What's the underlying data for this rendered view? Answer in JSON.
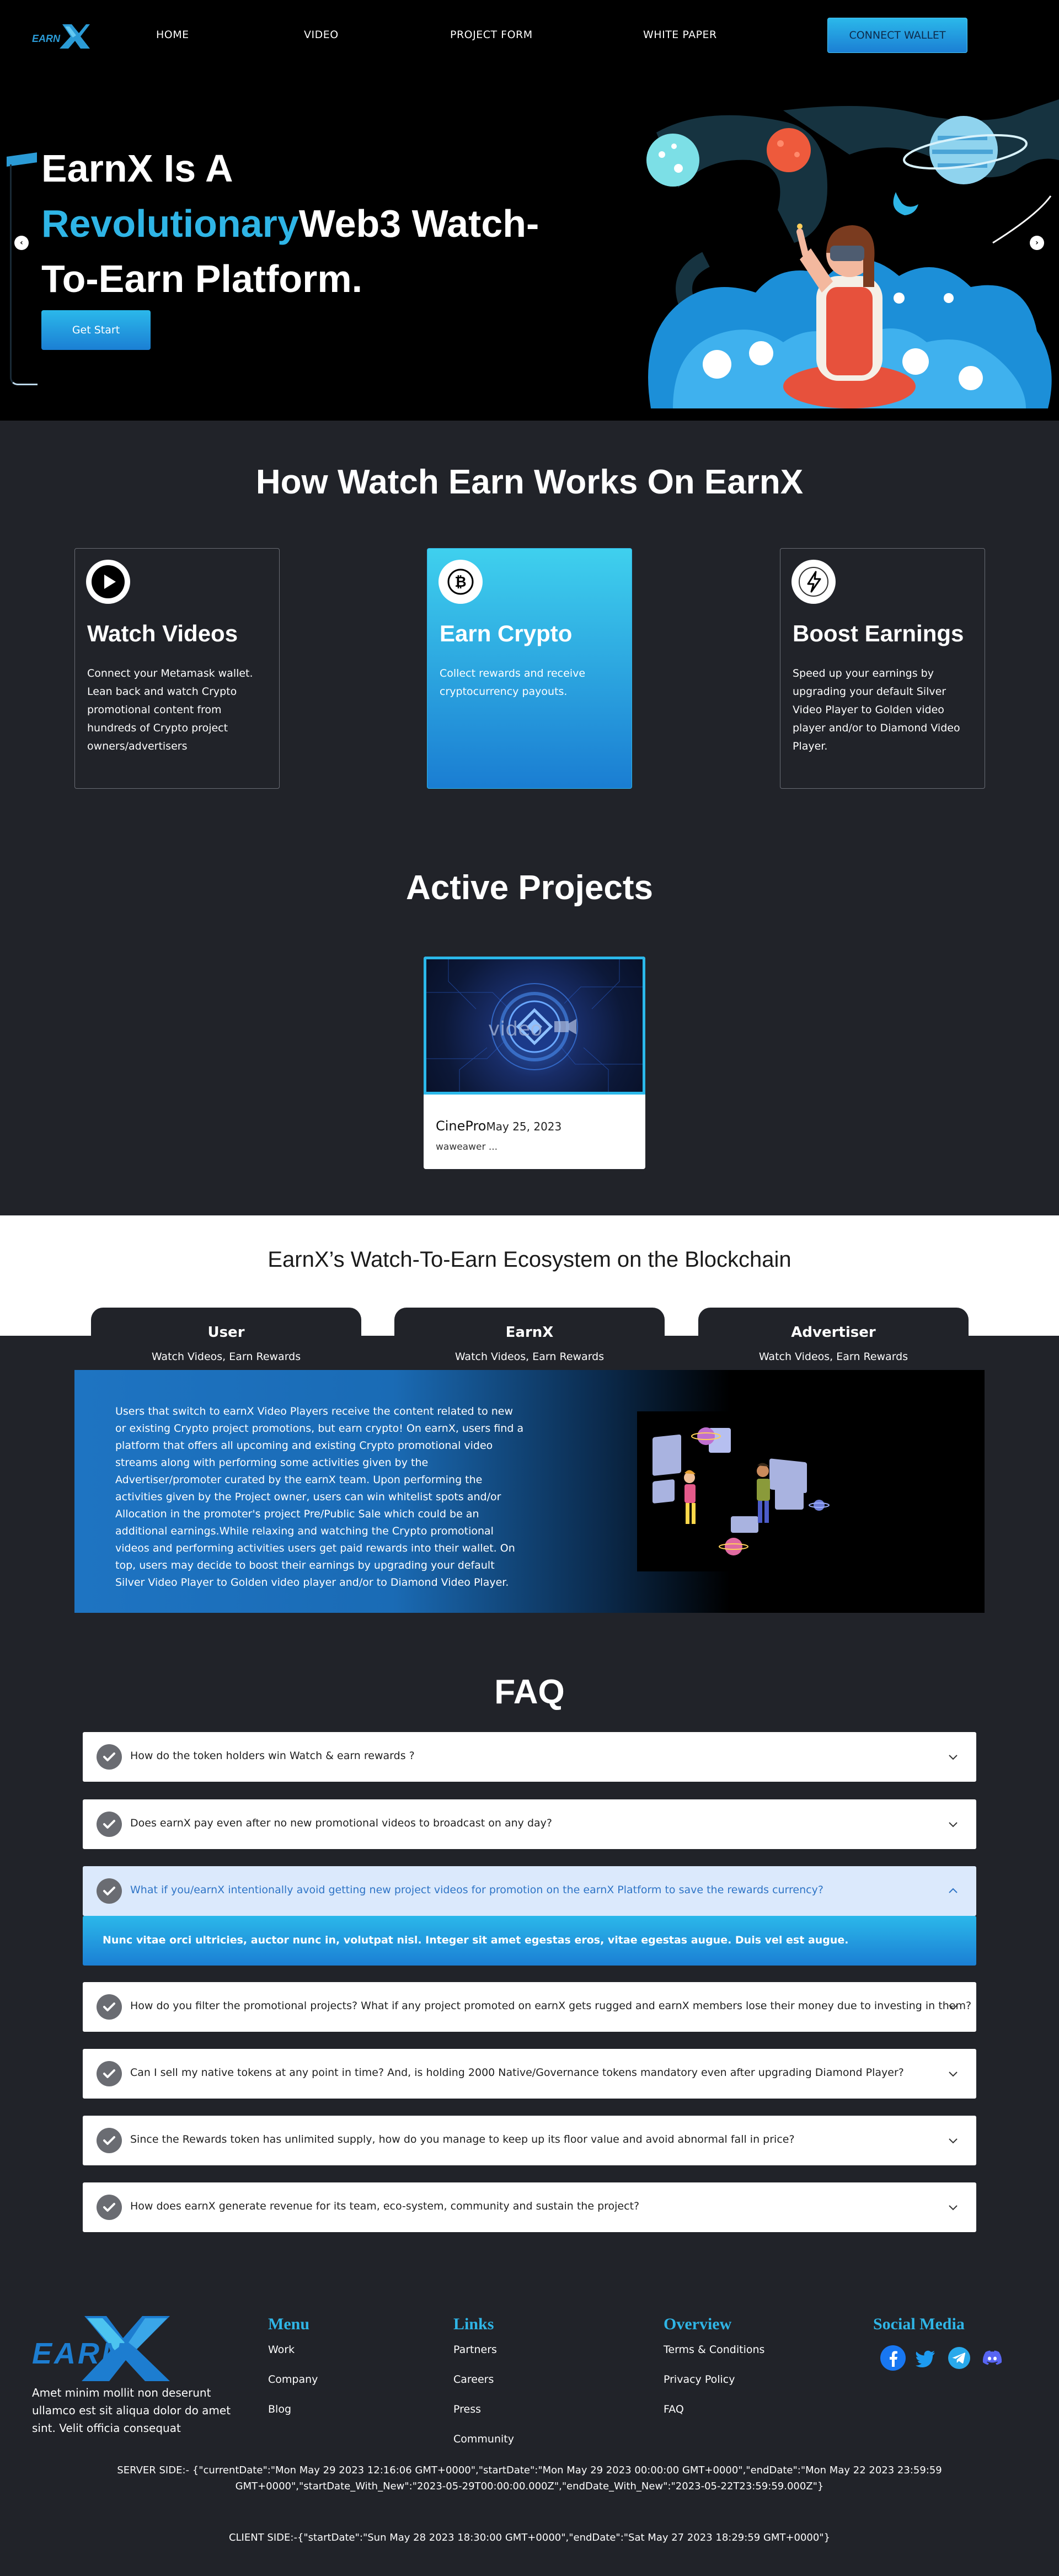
{
  "nav": {
    "logo_text": "EARN",
    "links": [
      "HOME",
      "VIDEO",
      "PROJECT FORM",
      "WHITE PAPER"
    ],
    "connect_wallet": "CONNECT WALLET"
  },
  "hero": {
    "title_line1": "EarnX Is A",
    "title_highlight": "Revolutionary",
    "title_line2_rest": "Web3 Watch-",
    "title_line3": "To-Earn Platform.",
    "cta": "Get Start",
    "prev_arrow": "‹",
    "next_arrow": "›"
  },
  "how": {
    "title": "How Watch Earn Works On EarnX",
    "cards": [
      {
        "title": "Watch Videos",
        "text": "Connect your Metamask wallet. Lean back and watch Crypto promotional content from hundreds of Crypto project owners/advertisers",
        "icon": "play-icon"
      },
      {
        "title": "Earn Crypto",
        "text": "Collect rewards and receive cryptocurrency payouts.",
        "icon": "bitcoin-icon"
      },
      {
        "title": "Boost Earnings",
        "text": "Speed up your earnings by upgrading your default Silver Video Player to Golden video player and/or to Diamond Video Player.",
        "icon": "lightning-icon"
      }
    ]
  },
  "projects": {
    "title": "Active Projects",
    "items": [
      {
        "name": "CinePro",
        "date": "May 25, 2023",
        "subtitle": "waweawer ...",
        "thumb_text": "video"
      }
    ]
  },
  "ecosystem": {
    "title": "EarnX’s Watch-To-Earn Ecosystem on the Blockchain",
    "tabs": [
      {
        "title": "User",
        "subtitle": "Watch Videos, Earn Rewards"
      },
      {
        "title": "EarnX",
        "subtitle": "Watch Videos, Earn Rewards"
      },
      {
        "title": "Advertiser",
        "subtitle": "Watch Videos, Earn Rewards"
      }
    ],
    "text": "Users that switch to earnX Video Players receive the content related to new or existing Crypto project promotions, but earn crypto! On earnX, users find a platform that offers all upcoming and existing Crypto promotional video streams along with performing some activities given by the Advertiser/promoter curated by the earnX team. Upon performing the activities given by the Project owner, users can win whitelist spots and/or Allocation in the promoter's project Pre/Public Sale which could be an additional earnings.While relaxing and watching the Crypto promotional videos and performing activities users get paid rewards into their wallet. On top, users may decide to boost their earnings by upgrading your default Silver Video Player to Golden video player and/or to Diamond Video Player."
  },
  "faq": {
    "title": "FAQ",
    "items": [
      "How do the token holders win Watch & earn rewards ?",
      "Does earnX pay even after no new promotional videos to broadcast on any day?",
      "What if you/earnX intentionally avoid getting new project videos for promotion on the earnX Platform to save the rewards currency?",
      "How do you filter the promotional projects? What if any project promoted on earnX gets rugged and earnX members lose their money due to investing in them?",
      "Can I sell my native tokens at any point in time? And, is holding 2000 Native/Governance tokens mandatory even after upgrading Diamond Player?",
      "Since the Rewards token has unlimited supply, how do you manage to keep up its floor value and avoid abnormal fall in price?",
      "How does earnX generate revenue for its team, eco-system, community and sustain the project?"
    ],
    "open_index": 2,
    "open_answer": "Nunc vitae orci ultricies, auctor nunc in, volutpat nisl. Integer sit amet egestas eros, vitae egestas augue. Duis vel est augue."
  },
  "footer": {
    "logo_text": "EARN",
    "about": "Amet minim mollit non deserunt ullamco est sit aliqua dolor do amet sint. Velit officia consequat",
    "menu": {
      "title": "Menu",
      "links": [
        "Work",
        "Company",
        "Blog"
      ]
    },
    "links": {
      "title": "Links",
      "links": [
        "Partners",
        "Careers",
        "Press",
        "Community"
      ]
    },
    "overview": {
      "title": "Overview",
      "links": [
        "Terms & Conditions",
        "Privacy Policy",
        "FAQ"
      ]
    },
    "social": {
      "title": "Social Media",
      "icons": [
        "facebook-icon",
        "twitter-icon",
        "telegram-icon",
        "discord-icon"
      ]
    },
    "server_side_1": "SERVER SIDE:- {\"currentDate\":\"Mon May 29 2023 12:16:06 GMT+0000\",\"startDate\":\"Mon May 29 2023 00:00:00 GMT+0000\",\"endDate\":\"Mon May 22 2023 23:59:59",
    "server_side_2": "GMT+0000\",\"startDate_With_New\":\"2023-05-29T00:00:00.000Z\",\"endDate_With_New\":\"2023-05-22T23:59:59.000Z\"}",
    "client_side": "CLIENT SIDE:-{\"startDate\":\"Sun May 28 2023 18:30:00 GMT+0000\",\"endDate\":\"Sat May 27 2023 18:29:59 GMT+0000\"}"
  },
  "colors": {
    "accent": "#2fb5e6",
    "page_bg": "#212329",
    "nav_bg": "#000000"
  }
}
